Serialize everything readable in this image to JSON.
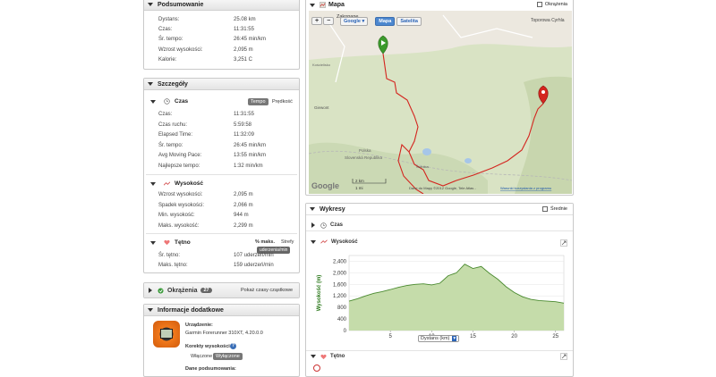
{
  "summary": {
    "title": "Podsumowanie",
    "rows": [
      {
        "label": "Dystans:",
        "value": "25.08 km"
      },
      {
        "label": "Czas:",
        "value": "11:31:55"
      },
      {
        "label": "Śr. tempo:",
        "value": "26:45 min/km"
      },
      {
        "label": "Wzrost wysokości:",
        "value": "2,095 m"
      },
      {
        "label": "Kalorie:",
        "value": "3,251 C"
      }
    ]
  },
  "details": {
    "title": "Szczegóły",
    "time_section": {
      "title": "Czas",
      "toggle_active": "Tempo",
      "toggle_other": "Prędkość",
      "rows": [
        {
          "label": "Czas:",
          "value": "11:31:55"
        },
        {
          "label": "Czas ruchu:",
          "value": "5:59:58"
        },
        {
          "label": "Elapsed Time:",
          "value": "11:32:09"
        },
        {
          "label": "Śr. tempo:",
          "value": "26:45 min/km"
        },
        {
          "label": "Avg Moving Pace:",
          "value": "13:55 min/km"
        },
        {
          "label": "Najlepsze tempo:",
          "value": "1:32 min/km"
        }
      ]
    },
    "elevation_section": {
      "title": "Wysokość",
      "rows": [
        {
          "label": "Wzrost wysokości:",
          "value": "2,095 m"
        },
        {
          "label": "Spadek wysokości:",
          "value": "2,066 m"
        },
        {
          "label": "Min. wysokość:",
          "value": "944 m"
        },
        {
          "label": "Maks. wysokość:",
          "value": "2,299 m"
        }
      ]
    },
    "hr_section": {
      "title": "Tętno",
      "tab1": "% maks.",
      "tab2": "Strefy",
      "tooltip": "uderzenia/min",
      "rows": [
        {
          "label": "Śr. tętno:",
          "value": "107 uderzeń/min"
        },
        {
          "label": "Maks. tętno:",
          "value": "159 uderzeń/min"
        }
      ]
    }
  },
  "laps": {
    "title": "Okrążenia",
    "count": "27",
    "link": "Pokaż czasy cząstkowe"
  },
  "additional": {
    "title": "Informacje dodatkowe",
    "device_label": "Urządzenie:",
    "device_value": "Garmin Forerunner 310XT, 4.20.0.0",
    "elev_corr_label": "Korekty wysokości",
    "elev_corr_help": "?",
    "elev_corr_on": "Włączone",
    "elev_corr_off": "Wyłączone",
    "data_label": "Dane podsumowania:"
  },
  "map": {
    "title": "Mapa",
    "laps_checkbox": "Okrążenia",
    "zoom_in": "+",
    "zoom_out": "−",
    "provider": "Google",
    "provider_arrow": "▾",
    "btn_map": "Mapa",
    "btn_satellite": "Satelita",
    "places": {
      "zakopane": "Zakopane",
      "toporowa": "Toporowa Cyrhla",
      "glewont": "Giewont",
      "polska": "Polska",
      "slovakia": "Slovenská Republika",
      "swinica": "Świnica",
      "kosc": "Kościelisko"
    },
    "scale_km": "2 km",
    "scale_mi": "1 mi",
    "google": "Google",
    "attribution": "Dane do Mapy ©2012 Google, Tele Atlas -",
    "report": "Warunki korzystania z programu"
  },
  "charts_panel": {
    "title": "Wykresy",
    "avg_label": "Średnie",
    "time_row": "Czas",
    "elev_row": "Wysokość",
    "hr_row": "Tętno",
    "x_select": "Dystans (km)",
    "x_select_arrow": "▾"
  },
  "chart_data": {
    "type": "area",
    "title": "",
    "ylabel": "Wysokość (m)",
    "xlabel": "Dystans (km)",
    "xlim": [
      0,
      26
    ],
    "ylim": [
      0,
      2600
    ],
    "yticks": [
      "2,400",
      "2,000",
      "1,600",
      "1,200",
      "800",
      "400",
      "0"
    ],
    "xticks": [
      "5",
      "10",
      "15",
      "20",
      "25"
    ],
    "series": [
      {
        "name": "",
        "x": [
          0,
          1,
          2,
          3,
          4,
          5,
          6,
          7,
          8,
          9,
          10,
          11,
          12,
          13,
          14,
          15,
          16,
          17,
          18,
          19,
          20,
          21,
          22,
          23,
          24,
          25,
          26
        ],
        "values": [
          1020,
          1100,
          1200,
          1290,
          1350,
          1420,
          1500,
          1560,
          1600,
          1620,
          1580,
          1640,
          1900,
          2000,
          2300,
          2150,
          2220,
          1980,
          1780,
          1520,
          1320,
          1170,
          1080,
          1040,
          1020,
          1000,
          950
        ]
      }
    ],
    "fill_color": "#c5dcaa",
    "line_color": "#4a8a2f"
  }
}
